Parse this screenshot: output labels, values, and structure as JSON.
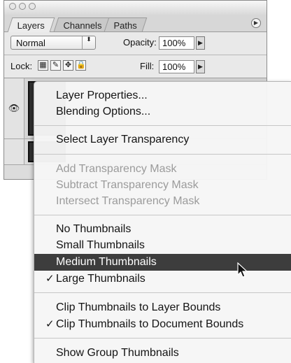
{
  "palette": {
    "tabs": [
      "Layers",
      "Channels",
      "Paths"
    ],
    "blend_mode": "Normal",
    "opacity_label": "Opacity:",
    "opacity_value": "100%",
    "lock_label": "Lock:",
    "fill_label": "Fill:",
    "fill_value": "100%",
    "flyout_icon": "▶",
    "dropdown_icon": "⬍",
    "arrow_icon": "▶",
    "eye_icon": "👁",
    "lock_icons": [
      "▦",
      "✎",
      "✥",
      "🔒"
    ]
  },
  "menu": {
    "group1": [
      "Layer Properties...",
      "Blending Options..."
    ],
    "group2": [
      "Select Layer Transparency"
    ],
    "group3_disabled": [
      "Add Transparency Mask",
      "Subtract Transparency Mask",
      "Intersect Transparency Mask"
    ],
    "thumbs": [
      "No Thumbnails",
      "Small Thumbnails",
      "Medium Thumbnails",
      "Large Thumbnails"
    ],
    "thumbs_checked": 3,
    "thumbs_highlighted": 2,
    "clip": [
      "Clip Thumbnails to Layer Bounds",
      "Clip Thumbnails to Document Bounds"
    ],
    "clip_checked": 1,
    "last": [
      "Show Group Thumbnails"
    ],
    "check_mark": "✓"
  },
  "colors": {
    "highlight": "#3d3d3d",
    "disabled_text": "#9b9b9b"
  }
}
